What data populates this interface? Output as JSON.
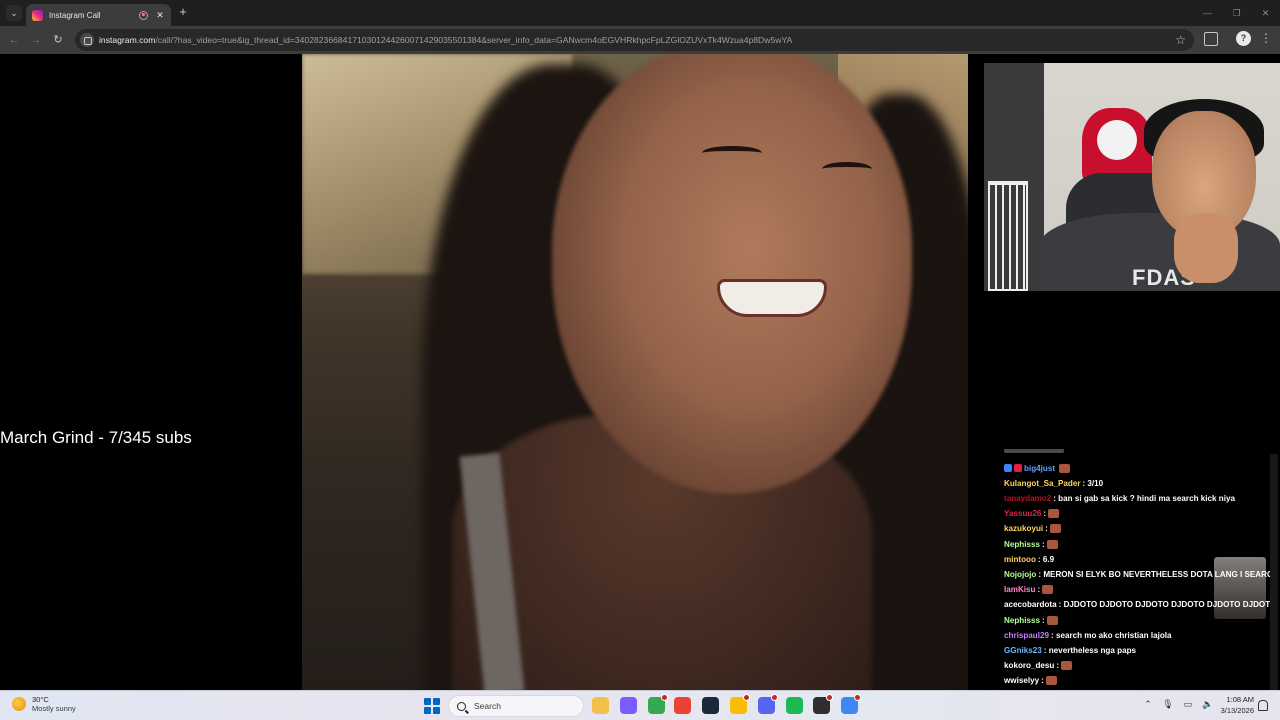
{
  "browser": {
    "tab": {
      "title": "Instagram Call"
    },
    "new_tab_label": "+",
    "address": {
      "domain": "instagram.com",
      "path": "/call/?has_video=true&ig_thread_id=340282366841710301244260071429035501384&server_info_data=GANwcm4oEGVHRkhpcFpLZGlOZUVxTk4Wzua4p8Dw5wYA"
    }
  },
  "overlay": {
    "text": "March Grind - 7/345 subs"
  },
  "self_view": {
    "shirt_text": "FDAS"
  },
  "chat": {
    "messages": [
      {
        "user": "big4just",
        "color": "#5aa0ff",
        "text": "",
        "emote": true,
        "badges": [
          "#3b82f6",
          "#e11d48"
        ]
      },
      {
        "user": "Kulangot_Sa_Pader",
        "color": "#ffd65a",
        "text": ": 3/10",
        "emote": false
      },
      {
        "user": "tanaydamo2",
        "color": "#b3121f",
        "text": ": ban si gab sa kick ? hindi ma search kick niya",
        "emote": false
      },
      {
        "user": "Yassuu26",
        "color": "#e0244a",
        "text": ":",
        "emote": true
      },
      {
        "user": "kazukoyui",
        "color": "#ffd65a",
        "text": ":",
        "emote": true
      },
      {
        "user": "Nephisss",
        "color": "#b6ff9a",
        "text": ":",
        "emote": true
      },
      {
        "user": "mintooo",
        "color": "#ffd65a",
        "text": ": 6.9",
        "emote": false
      },
      {
        "user": "Nojojojo",
        "color": "#b6ff9a",
        "text": ": MERON SI ELYK BO NEVERTHELESS DOTA LANG I SEARCH",
        "emote": false
      },
      {
        "user": "IamKisu",
        "color": "#ff8ad0",
        "text": ":",
        "emote": true
      },
      {
        "user": "acecobardota",
        "color": "#ffffff",
        "text": ": DJDOTO DJDOTO DJDOTO DJDOTO DJDOTO DJDOTO",
        "emote": false
      },
      {
        "user": "Nephisss",
        "color": "#b6ff9a",
        "text": ":",
        "emote": true
      },
      {
        "user": "chrispaul29",
        "color": "#c77dff",
        "text": ": search mo ako christian lajola",
        "emote": false
      },
      {
        "user": "GGniks23",
        "color": "#6fb6ff",
        "text": ": nevertheless nga paps",
        "emote": false
      },
      {
        "user": "kokoro_desu",
        "color": "#ffffff",
        "text": ":",
        "emote": true
      },
      {
        "user": "wwiselyy",
        "color": "#ffffff",
        "text": ":",
        "emote": true
      }
    ]
  },
  "taskbar": {
    "weather": {
      "temp": "30°C",
      "desc": "Mostly sunny"
    },
    "search_label": "Search",
    "clock": {
      "time": "1:08 AM",
      "date": "3/13/2026"
    },
    "apps": [
      {
        "name": "file-explorer",
        "color": "#f2c14b"
      },
      {
        "name": "copilot",
        "color": "#7a5cff"
      },
      {
        "name": "chrome-profile-1",
        "color": "#34a853",
        "badge": true
      },
      {
        "name": "chrome",
        "color": "#ea4335"
      },
      {
        "name": "steam",
        "color": "#1b2838"
      },
      {
        "name": "chrome-profile-2",
        "color": "#fbbc05",
        "badge": true
      },
      {
        "name": "discord",
        "color": "#5865f2",
        "badge": true
      },
      {
        "name": "media-app",
        "color": "#1db954"
      },
      {
        "name": "obs",
        "color": "#302e31",
        "badge": true
      },
      {
        "name": "chrome-profile-3",
        "color": "#4285f4",
        "badge": true
      }
    ]
  }
}
